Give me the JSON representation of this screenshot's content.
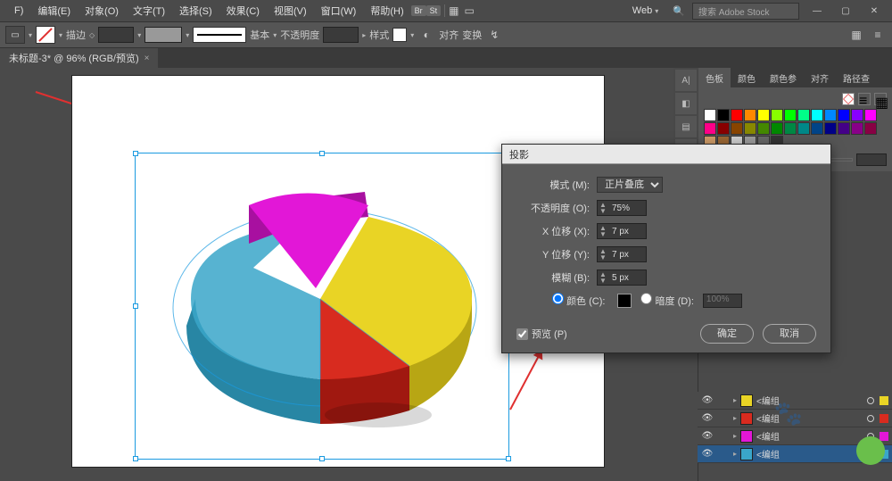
{
  "menu": {
    "items": [
      "F)",
      "编辑(E)",
      "对象(O)",
      "文字(T)",
      "选择(S)",
      "效果(C)",
      "视图(V)",
      "窗口(W)",
      "帮助(H)"
    ],
    "badges": [
      "Br",
      "St"
    ],
    "right_label": "Web",
    "search_placeholder": "搜索 Adobe Stock"
  },
  "toolbar": {
    "stroke_label": "描边",
    "stroke_style": "基本",
    "opacity_label": "不透明度",
    "style_label": "样式",
    "align_label": "对齐",
    "transform_label": "变换"
  },
  "tab": {
    "title": "未标题-3* @ 96% (RGB/预览)"
  },
  "chart_data": {
    "type": "pie",
    "title": "",
    "slices": [
      {
        "label": "蓝",
        "value": 40,
        "color": "#3aa6c9"
      },
      {
        "label": "品红",
        "value": 20,
        "color": "#e217d7"
      },
      {
        "label": "黄",
        "value": 25,
        "color": "#e9d425"
      },
      {
        "label": "红",
        "value": 15,
        "color": "#d82b1f"
      }
    ]
  },
  "panel": {
    "tabs": [
      "色板",
      "颜色",
      "颜色参",
      "对齐",
      "路径查"
    ],
    "swatches": [
      "#fff",
      "#000",
      "#ff0000",
      "#ff8800",
      "#ffff00",
      "#88ff00",
      "#00ff00",
      "#00ff88",
      "#00ffff",
      "#0088ff",
      "#0000ff",
      "#8800ff",
      "#ff00ff",
      "#ff0088",
      "#880000",
      "#884400",
      "#888800",
      "#448800",
      "#008800",
      "#008844",
      "#008888",
      "#004488",
      "#000088",
      "#440088",
      "#880088",
      "#880044",
      "#cc9966",
      "#996633",
      "#cccccc",
      "#999999",
      "#666666",
      "#333333"
    ]
  },
  "layers": {
    "label": "<编组",
    "items": [
      {
        "color": "#e9d425"
      },
      {
        "color": "#d82b1f"
      },
      {
        "color": "#e217d7"
      },
      {
        "color": "#3aa6c9"
      }
    ],
    "selected": 3
  },
  "dialog": {
    "title": "投影",
    "mode_label": "模式 (M):",
    "mode_value": "正片叠底",
    "opacity_label": "不透明度 (O):",
    "opacity_value": "75%",
    "x_label": "X 位移 (X):",
    "x_value": "7 px",
    "y_label": "Y 位移 (Y):",
    "y_value": "7 px",
    "blur_label": "模糊 (B):",
    "blur_value": "5 px",
    "color_label": "颜色 (C):",
    "dark_label": "暗度 (D):",
    "dark_value": "100%",
    "preview_label": "预览 (P)",
    "ok": "确定",
    "cancel": "取消"
  }
}
